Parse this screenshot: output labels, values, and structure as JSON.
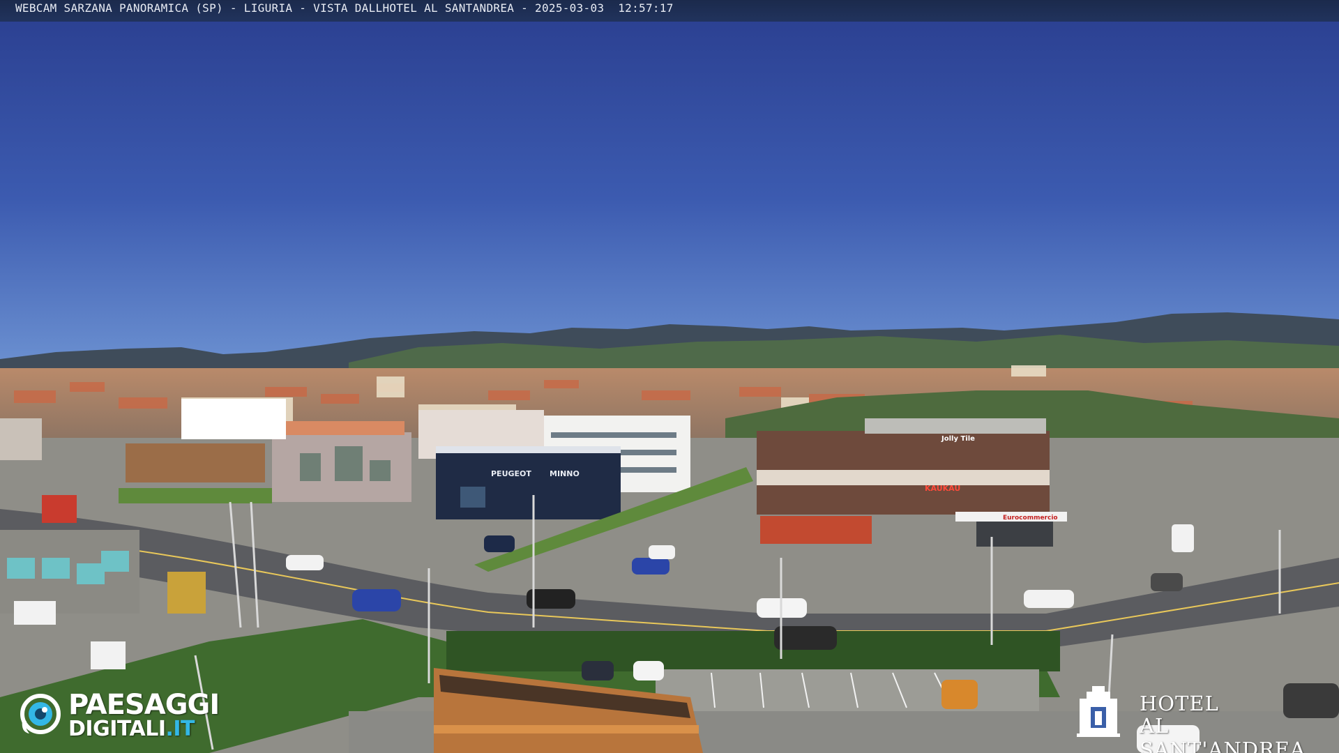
{
  "title_bar": {
    "webcam": "WEBCAM SARZANA PANORAMICA (SP)",
    "sep1": " - ",
    "region": "LIGURIA",
    "sep2": " - ",
    "view": "VISTA DALLHOTEL AL SANTANDREA",
    "sep3": " - ",
    "date": "2025-03-03",
    "time": "12:57:17"
  },
  "scene": {
    "dealer_sign": "PEUGEOT",
    "dealer_name": "MINNO",
    "restaurant_sign": "KAUKAU",
    "shop_sign": "Jolly Tile",
    "honda_sign": "Eurocommercio"
  },
  "logos": {
    "paesaggi_line1": "PAESAGGI",
    "paesaggi_line2_main": "DIGITALI",
    "paesaggi_line2_suffix": ".IT",
    "hotel_line1": "HOTEL",
    "hotel_line2": "AL SANT'ANDREA"
  },
  "colors": {
    "sky_top": "#2a3e8f",
    "sky_bottom": "#5a82c8",
    "title_bar": "#1b2a4c",
    "brand_accent": "#33b7e6"
  },
  "icons": {
    "paesaggi": "eye-logo-icon",
    "hotel": "hotel-crest-icon"
  }
}
